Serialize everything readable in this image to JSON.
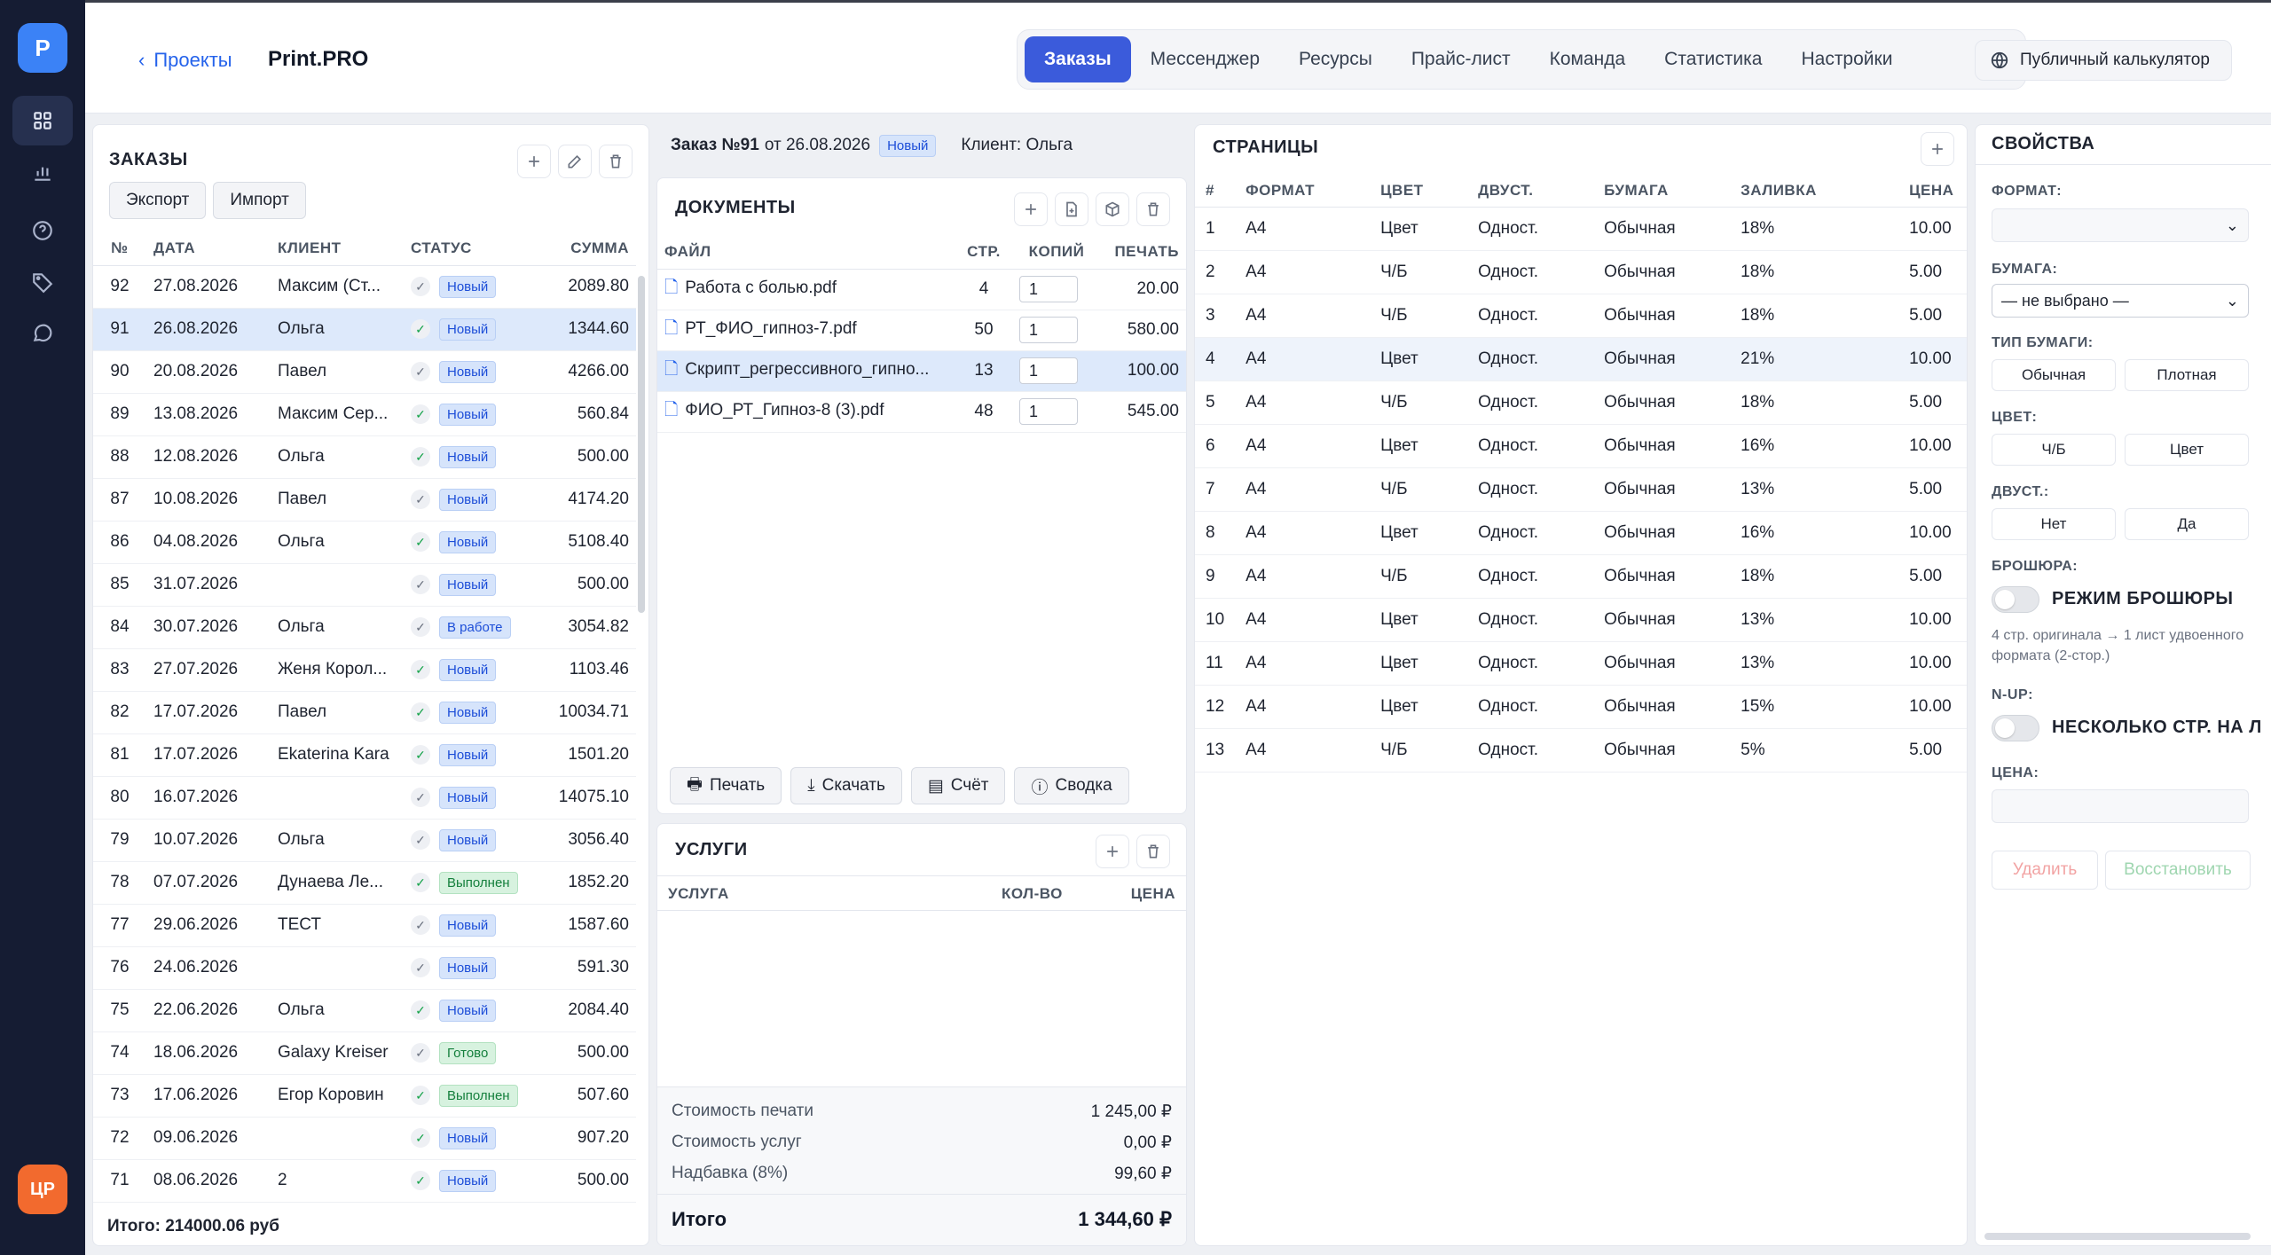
{
  "colors": {
    "accent": "#3b5bdb",
    "sidebar": "#151c33",
    "avatar": "#f26a2e",
    "status_new": "#1d4ed8",
    "status_done": "#15803d"
  },
  "sidebar": {
    "logo": "P",
    "avatar": "ЦР",
    "icons": [
      "grid-icon",
      "chart-icon",
      "help-icon",
      "tag-icon",
      "chat-icon"
    ]
  },
  "header": {
    "back_label": "Проекты",
    "app_name": "Print.PRO",
    "tabs": [
      "Заказы",
      "Мессенджер",
      "Ресурсы",
      "Прайс-лист",
      "Команда",
      "Статистика",
      "Настройки"
    ],
    "public_calc": "Публичный калькулятор"
  },
  "orders": {
    "title": "ЗАКАЗЫ",
    "export": "Экспорт",
    "import": "Импорт",
    "columns": [
      "№",
      "ДАТА",
      "КЛИЕНТ",
      "СТАТУС",
      "СУММА"
    ],
    "rows": [
      {
        "no": "92",
        "date": "27.08.2026",
        "client": "Максим (Ст...",
        "status": "Новый",
        "sum": "2089.80"
      },
      {
        "no": "91",
        "date": "26.08.2026",
        "client": "Ольга",
        "status": "Новый",
        "sum": "1344.60"
      },
      {
        "no": "90",
        "date": "20.08.2026",
        "client": "Павел",
        "status": "Новый",
        "sum": "4266.00"
      },
      {
        "no": "89",
        "date": "13.08.2026",
        "client": "Максим Сер...",
        "status": "Новый",
        "sum": "560.84"
      },
      {
        "no": "88",
        "date": "12.08.2026",
        "client": "Ольга",
        "status": "Новый",
        "sum": "500.00"
      },
      {
        "no": "87",
        "date": "10.08.2026",
        "client": "Павел",
        "status": "Новый",
        "sum": "4174.20"
      },
      {
        "no": "86",
        "date": "04.08.2026",
        "client": "Ольга",
        "status": "Новый",
        "sum": "5108.40"
      },
      {
        "no": "85",
        "date": "31.07.2026",
        "client": "",
        "status": "Новый",
        "sum": "500.00"
      },
      {
        "no": "84",
        "date": "30.07.2026",
        "client": "Ольга",
        "status": "В работе",
        "sum": "3054.82"
      },
      {
        "no": "83",
        "date": "27.07.2026",
        "client": "Женя Корол...",
        "status": "Новый",
        "sum": "1103.46"
      },
      {
        "no": "82",
        "date": "17.07.2026",
        "client": "Павел",
        "status": "Новый",
        "sum": "10034.71"
      },
      {
        "no": "81",
        "date": "17.07.2026",
        "client": "Ekaterina Kara",
        "status": "Новый",
        "sum": "1501.20"
      },
      {
        "no": "80",
        "date": "16.07.2026",
        "client": "",
        "status": "Новый",
        "sum": "14075.10"
      },
      {
        "no": "79",
        "date": "10.07.2026",
        "client": "Ольга",
        "status": "Новый",
        "sum": "3056.40"
      },
      {
        "no": "78",
        "date": "07.07.2026",
        "client": "Дунаева Ле...",
        "status": "Выполнен",
        "sum": "1852.20"
      },
      {
        "no": "77",
        "date": "29.06.2026",
        "client": "ТЕСТ",
        "status": "Новый",
        "sum": "1587.60"
      },
      {
        "no": "76",
        "date": "24.06.2026",
        "client": "",
        "status": "Новый",
        "sum": "591.30"
      },
      {
        "no": "75",
        "date": "22.06.2026",
        "client": "Ольга",
        "status": "Новый",
        "sum": "2084.40"
      },
      {
        "no": "74",
        "date": "18.06.2026",
        "client": "Galaxy Kreiser",
        "status": "Готово",
        "sum": "500.00"
      },
      {
        "no": "73",
        "date": "17.06.2026",
        "client": "Егор Коровин",
        "status": "Выполнен",
        "sum": "507.60"
      },
      {
        "no": "72",
        "date": "09.06.2026",
        "client": "",
        "status": "Новый",
        "sum": "907.20"
      },
      {
        "no": "71",
        "date": "08.06.2026",
        "client": "2",
        "status": "Новый",
        "sum": "500.00"
      }
    ],
    "total": "Итого: 214000.06 руб"
  },
  "order": {
    "title_prefix": "Заказ №91",
    "date": "от 26.08.2026",
    "status": "Новый",
    "client": "Клиент: Ольга"
  },
  "documents": {
    "title": "ДОКУМЕНТЫ",
    "columns": [
      "ФАЙЛ",
      "СТР.",
      "КОПИЙ",
      "ПЕЧАТЬ"
    ],
    "rows": [
      {
        "file": "Работа с болью.pdf",
        "pages": "4",
        "copies": "1",
        "print": "20.00"
      },
      {
        "file": "РТ_ФИО_гипноз-7.pdf",
        "pages": "50",
        "copies": "1",
        "print": "580.00"
      },
      {
        "file": "Скрипт_регрессивного_гипно...",
        "pages": "13",
        "copies": "1",
        "print": "100.00"
      },
      {
        "file": "ФИО_РТ_Гипноз-8 (3).pdf",
        "pages": "48",
        "copies": "1",
        "print": "545.00"
      }
    ],
    "actions": [
      "Печать",
      "Скачать",
      "Счёт",
      "Сводка"
    ]
  },
  "services": {
    "title": "УСЛУГИ",
    "columns": [
      "УСЛУГА",
      "КОЛ-ВО",
      "ЦЕНА"
    ],
    "print_cost_label": "Стоимость печати",
    "print_cost": "1 245,00 ₽",
    "service_cost_label": "Стоимость услуг",
    "service_cost": "0,00 ₽",
    "markup_label": "Надбавка (8%)",
    "markup": "99,60 ₽",
    "total_label": "Итого",
    "total": "1 344,60 ₽"
  },
  "pages": {
    "title": "СТРАНИЦЫ",
    "columns": [
      "#",
      "ФОРМАТ",
      "ЦВЕТ",
      "ДВУСТ.",
      "БУМАГА",
      "ЗАЛИВКА",
      "ЦЕНА"
    ],
    "rows": [
      {
        "n": "1",
        "format": "A4",
        "color": "Цвет",
        "duplex": "Одност.",
        "paper": "Обычная",
        "fill": "18%",
        "price": "10.00"
      },
      {
        "n": "2",
        "format": "A4",
        "color": "Ч/Б",
        "duplex": "Одност.",
        "paper": "Обычная",
        "fill": "18%",
        "price": "5.00"
      },
      {
        "n": "3",
        "format": "A4",
        "color": "Ч/Б",
        "duplex": "Одност.",
        "paper": "Обычная",
        "fill": "18%",
        "price": "5.00"
      },
      {
        "n": "4",
        "format": "A4",
        "color": "Цвет",
        "duplex": "Одност.",
        "paper": "Обычная",
        "fill": "21%",
        "price": "10.00"
      },
      {
        "n": "5",
        "format": "A4",
        "color": "Ч/Б",
        "duplex": "Одност.",
        "paper": "Обычная",
        "fill": "18%",
        "price": "5.00"
      },
      {
        "n": "6",
        "format": "A4",
        "color": "Цвет",
        "duplex": "Одност.",
        "paper": "Обычная",
        "fill": "16%",
        "price": "10.00"
      },
      {
        "n": "7",
        "format": "A4",
        "color": "Ч/Б",
        "duplex": "Одност.",
        "paper": "Обычная",
        "fill": "13%",
        "price": "5.00"
      },
      {
        "n": "8",
        "format": "A4",
        "color": "Цвет",
        "duplex": "Одност.",
        "paper": "Обычная",
        "fill": "16%",
        "price": "10.00"
      },
      {
        "n": "9",
        "format": "A4",
        "color": "Ч/Б",
        "duplex": "Одност.",
        "paper": "Обычная",
        "fill": "18%",
        "price": "5.00"
      },
      {
        "n": "10",
        "format": "A4",
        "color": "Цвет",
        "duplex": "Одност.",
        "paper": "Обычная",
        "fill": "13%",
        "price": "10.00"
      },
      {
        "n": "11",
        "format": "A4",
        "color": "Цвет",
        "duplex": "Одност.",
        "paper": "Обычная",
        "fill": "13%",
        "price": "10.00"
      },
      {
        "n": "12",
        "format": "A4",
        "color": "Цвет",
        "duplex": "Одност.",
        "paper": "Обычная",
        "fill": "15%",
        "price": "10.00"
      },
      {
        "n": "13",
        "format": "A4",
        "color": "Ч/Б",
        "duplex": "Одност.",
        "paper": "Обычная",
        "fill": "5%",
        "price": "5.00"
      }
    ]
  },
  "properties": {
    "title": "СВОЙСТВА",
    "format_label": "ФОРМАТ:",
    "format_value": "",
    "paper_label": "БУМАГА:",
    "paper_value": "— не выбрано —",
    "paper_type_label": "ТИП БУМАГИ:",
    "paper_type_opts": [
      "Обычная",
      "Плотная"
    ],
    "color_label": "ЦВЕТ:",
    "color_opts": [
      "Ч/Б",
      "Цвет"
    ],
    "duplex_label": "ДВУСТ.:",
    "duplex_opts": [
      "Нет",
      "Да"
    ],
    "booklet_label": "БРОШЮРА:",
    "booklet_toggle": "РЕЖИМ БРОШЮРЫ",
    "booklet_hint": "4 стр. оригинала → 1 лист удвоенного формата (2-стор.)",
    "nup_label": "N-UP:",
    "nup_toggle": "НЕСКОЛЬКО СТР. НА Л",
    "price_label": "ЦЕНА:",
    "price_value": "",
    "delete": "Удалить",
    "restore": "Восстановить"
  }
}
